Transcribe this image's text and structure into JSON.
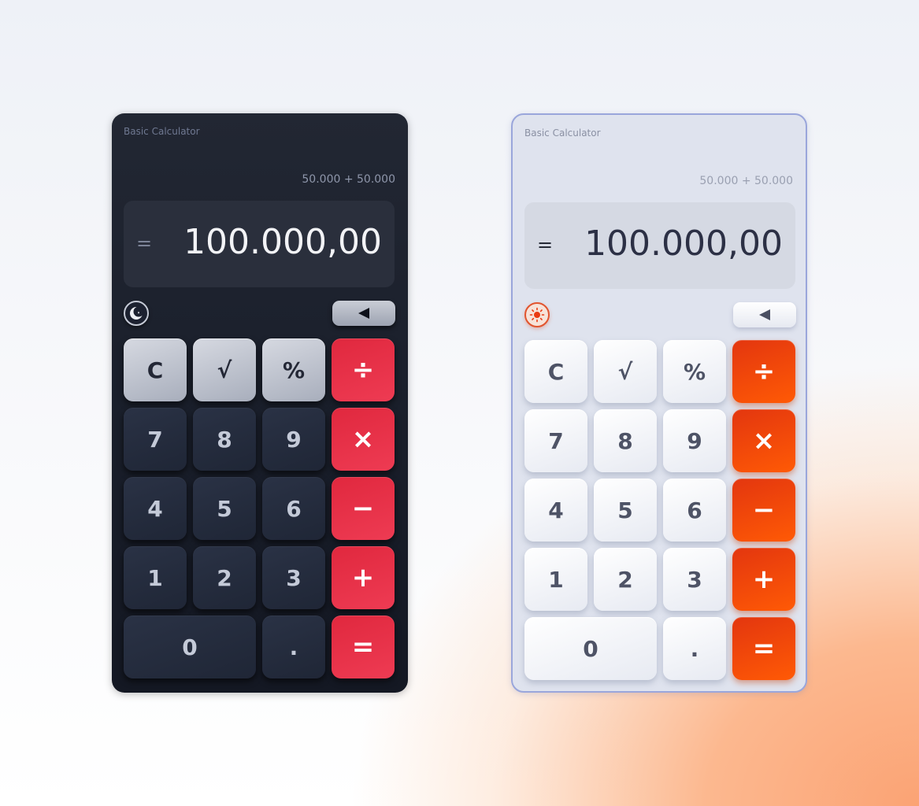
{
  "calculators": {
    "dark": {
      "title": "Basic Calculator",
      "expression": "50.000 + 50.000",
      "equals_sign": "=",
      "result": "100.000,00",
      "theme_icon": "moon-icon",
      "backspace_icon": "backspace-icon"
    },
    "light": {
      "title": "Basic Calculator",
      "expression": "50.000 + 50.000",
      "equals_sign": "=",
      "result": "100.000,00",
      "theme_icon": "sun-icon",
      "backspace_icon": "backspace-icon"
    }
  },
  "keys": {
    "clear": "C",
    "sqrt": "√",
    "percent": "%",
    "divide": "÷",
    "seven": "7",
    "eight": "8",
    "nine": "9",
    "multiply": "×",
    "four": "4",
    "five": "5",
    "six": "6",
    "minus": "−",
    "one": "1",
    "two": "2",
    "three": "3",
    "plus": "+",
    "zero": "0",
    "decimal": ".",
    "equals": "="
  },
  "colors": {
    "dark_body": "#1a1f2b",
    "dark_operator": "#e8304a",
    "dark_function": "#c3c7d1",
    "light_body": "#dfe3ee",
    "light_border": "#9aa6db",
    "light_operator": "#f04a0a",
    "page_accent": "#fba374"
  }
}
